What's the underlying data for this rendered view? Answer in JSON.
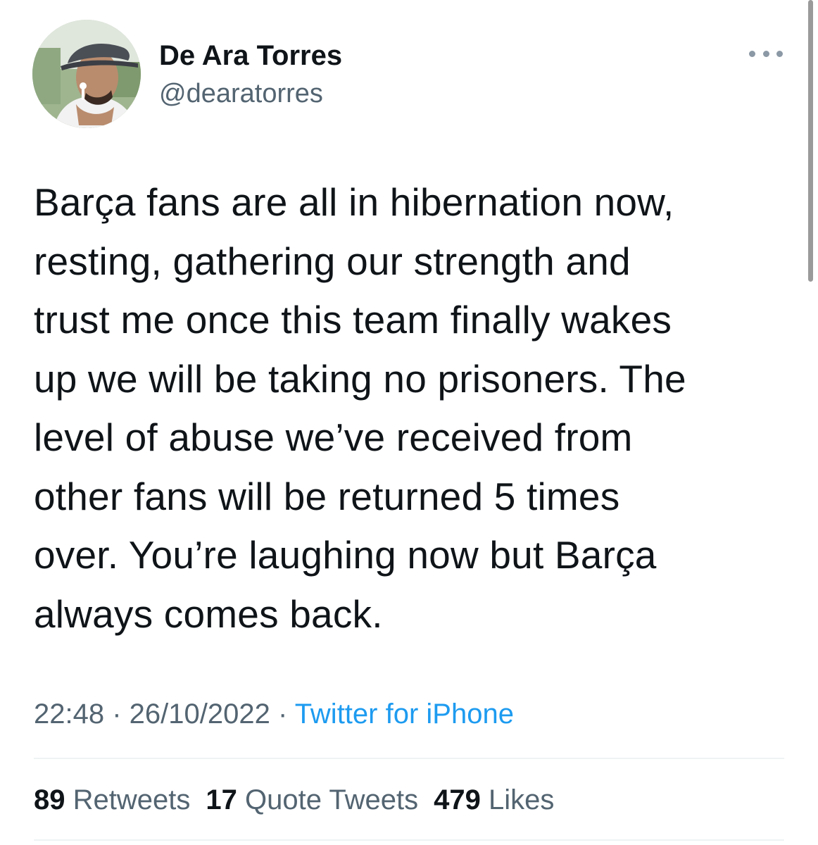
{
  "author": {
    "name": "De Ara Torres",
    "handle": "@dearatorres"
  },
  "icons": {
    "more": "more-horizontal-icon",
    "avatar": "profile-photo"
  },
  "tweet": {
    "text": "Barça fans are all in hibernation now,\nresting, gathering our strength and\ntrust me once this team finally wakes\nup we will be taking no prisoners. The\nlevel of abuse we’ve received from\nother fans will be returned 5 times\nover. You’re laughing now but Barça\nalways comes back.",
    "time": "22:48",
    "separator": " · ",
    "date": "26/10/2022",
    "source": "Twitter for iPhone"
  },
  "stats": {
    "retweets_count": "89",
    "retweets_label": "Retweets",
    "quotes_count": "17",
    "quotes_label": "Quote Tweets",
    "likes_count": "479",
    "likes_label": "Likes"
  },
  "colors": {
    "text": "#0f1419",
    "secondary": "#536471",
    "link": "#1d9bf0",
    "divider": "#eff3f4"
  }
}
